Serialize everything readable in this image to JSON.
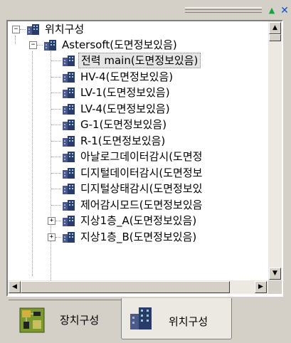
{
  "toolbar": {
    "up_icon": "triangle-up-icon",
    "close_icon": "close-x-icon"
  },
  "tree": {
    "root": {
      "label": "위치구성",
      "expand": "−"
    },
    "company": {
      "label": "Astersoft(도면정보있음)",
      "expand": "−"
    },
    "children": [
      {
        "label": "전력 main(도면정보있음)",
        "selected": true
      },
      {
        "label": "HV-4(도면정보있음)"
      },
      {
        "label": "LV-1(도면정보있음)"
      },
      {
        "label": "LV-4(도면정보있음)"
      },
      {
        "label": "G-1(도면정보있음)"
      },
      {
        "label": "R-1(도면정보있음)"
      },
      {
        "label": "아날로그데이터감시(도면정"
      },
      {
        "label": "디지털데이터감시(도면정보"
      },
      {
        "label": "디지털상태감시(도면정보있"
      },
      {
        "label": "제어감시모드(도면정보있음"
      },
      {
        "label": "지상1층_A(도면정보있음)",
        "expand": "+"
      },
      {
        "label": "지상1층_B(도면정보있음)",
        "expand": "+"
      }
    ]
  },
  "tabs": [
    {
      "label": "장치구성",
      "icon": "circuit-board-icon",
      "active": false
    },
    {
      "label": "위치구성",
      "icon": "buildings-icon",
      "active": true
    }
  ],
  "colors": {
    "background": "#d4d0c8",
    "panel": "#ffffff",
    "selection": "#e4e4e4"
  }
}
